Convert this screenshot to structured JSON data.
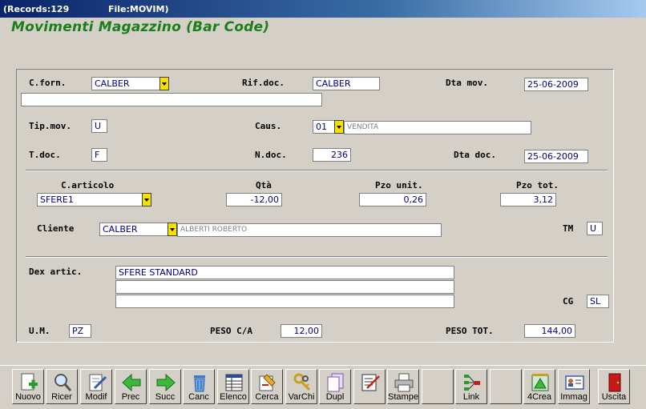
{
  "titlebar": {
    "records": "(Records:129",
    "file": "File:MOVIM)"
  },
  "heading": "Movimenti Magazzino (Bar Code)",
  "form": {
    "c_forn_label": "C.forn.",
    "c_forn_value": "CALBER",
    "rif_doc_label": "Rif.doc.",
    "rif_doc_value": "CALBER",
    "dta_mov_label": "Dta mov.",
    "dta_mov_value": "25-06-2009",
    "supplier_name_value": "",
    "tip_mov_label": "Tip.mov.",
    "tip_mov_value": "U",
    "caus_label": "Caus.",
    "caus_value": "01",
    "caus_desc": "VENDITA",
    "t_doc_label": "T.doc.",
    "t_doc_value": "F",
    "n_doc_label": "N.doc.",
    "n_doc_value": "236",
    "dta_doc_label": "Dta doc.",
    "dta_doc_value": "25-06-2009",
    "c_articolo_label": "C.articolo",
    "c_articolo_value": "SFERE1",
    "qta_label": "Qtà",
    "qta_value": "-12,00",
    "pzo_unit_label": "Pzo unit.",
    "pzo_unit_value": "0,26",
    "pzo_tot_label": "Pzo tot.",
    "pzo_tot_value": "3,12",
    "cliente_label": "Cliente",
    "cliente_value": "CALBER",
    "cliente_desc": "ALBERTI ROBERTO",
    "tm_label": "TM",
    "tm_value": "U",
    "dex_label": "Dex artic.",
    "dex_line1": "SFERE STANDARD",
    "dex_line2": "",
    "dex_line3": "",
    "cg_label": "CG",
    "cg_value": "SL",
    "um_label": "U.M.",
    "um_value": "PZ",
    "peso_ca_label": "PESO C/A",
    "peso_ca_value": "12,00",
    "peso_tot_label": "PESO TOT.",
    "peso_tot_value": "144,00"
  },
  "toolbar": {
    "nuovo": "Nuovo",
    "ricer": "Ricer",
    "modif": "Modif",
    "prec": "Prec",
    "succ": "Succ",
    "canc": "Canc",
    "elenco": "Elenco",
    "cerca": "Cerca",
    "varchi": "VarChi",
    "dupl": "Dupl",
    "blank1": "",
    "stampe": "Stampe",
    "blank2": "",
    "link": "Link",
    "blank3": "",
    "crea": "4Crea",
    "immag": "Immag",
    "uscita": "Uscita"
  },
  "colors": {
    "heading": "#1a7f1a",
    "value_text": "#00008b",
    "dropdown": "#f5e000"
  }
}
